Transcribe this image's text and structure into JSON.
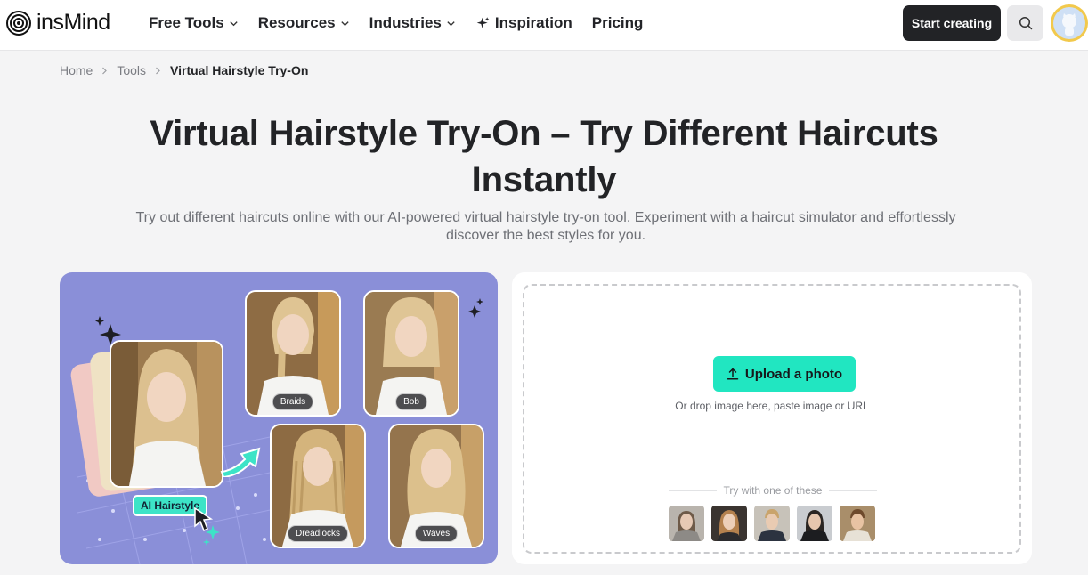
{
  "brand": {
    "name": "insMind"
  },
  "nav": {
    "items": [
      {
        "label": "Free Tools",
        "has_dropdown": true,
        "icon": "chevron-down-icon"
      },
      {
        "label": "Resources",
        "has_dropdown": true,
        "icon": "chevron-down-icon"
      },
      {
        "label": "Industries",
        "has_dropdown": true,
        "icon": "chevron-down-icon"
      },
      {
        "label": "Inspiration",
        "has_dropdown": false,
        "icon": "sparkle-icon"
      },
      {
        "label": "Pricing",
        "has_dropdown": false
      }
    ],
    "start_button": "Start creating",
    "search_icon": "search-icon",
    "avatar_icon": "github-avatar-icon"
  },
  "breadcrumb": [
    "Home",
    "Tools",
    "Virtual Hairstyle Try-On"
  ],
  "hero": {
    "title": "Virtual Hairstyle Try-On – Try Different Haircuts Instantly",
    "subtitle": "Try out different haircuts online with our AI-powered virtual hairstyle try-on tool. Experiment with a haircut simulator and effortlessly discover the best styles for you."
  },
  "showcase": {
    "main_tag": "AI Hairstyle",
    "styles": [
      "Braids",
      "Bob",
      "Dreadlocks",
      "Waves"
    ],
    "colors": {
      "background": "#8a8fd8",
      "accent": "#3de3c7"
    }
  },
  "upload": {
    "button": "Upload a photo",
    "hint": "Or drop image here, paste image or URL",
    "samples_label": "Try with one of these",
    "samples": [
      "sample-photo-1",
      "sample-photo-2",
      "sample-photo-3",
      "sample-photo-4",
      "sample-photo-5"
    ],
    "colors": {
      "button": "#21e6c1"
    }
  }
}
